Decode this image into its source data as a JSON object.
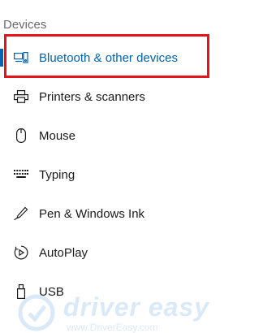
{
  "section": {
    "title": "Devices"
  },
  "nav": {
    "items": [
      {
        "label": "Bluetooth & other devices",
        "icon": "bluetooth-devices-icon",
        "selected": true
      },
      {
        "label": "Printers & scanners",
        "icon": "printer-icon"
      },
      {
        "label": "Mouse",
        "icon": "mouse-icon"
      },
      {
        "label": "Typing",
        "icon": "keyboard-icon"
      },
      {
        "label": "Pen & Windows Ink",
        "icon": "pen-icon"
      },
      {
        "label": "AutoPlay",
        "icon": "autoplay-icon"
      },
      {
        "label": "USB",
        "icon": "usb-icon"
      }
    ]
  },
  "watermark": {
    "brand": "driver easy",
    "url": "www.DriverEasy.com"
  },
  "colors": {
    "accent": "#0063b1",
    "highlight_border": "#e5141b",
    "text": "#1a1a1a",
    "muted": "#6a6a6a"
  }
}
